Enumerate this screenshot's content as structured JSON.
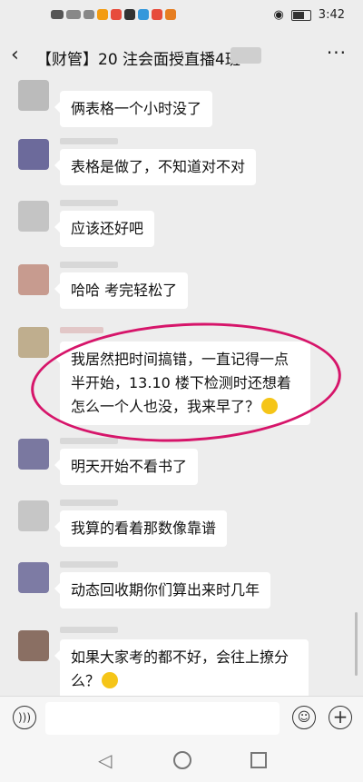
{
  "status_bar": {
    "time": "3:42"
  },
  "nav": {
    "back_icon": "chevron-left-icon",
    "title": "【财管】20 注会面授直播4班",
    "more_label": "···"
  },
  "messages": [
    {
      "text": "俩表格一个小时没了"
    },
    {
      "text": "表格是做了，不知道对不对"
    },
    {
      "text": "应该还好吧"
    },
    {
      "text": "哈哈 考完轻松了"
    },
    {
      "text": "我居然把时间搞错，一直记得一点半开始，13.10 楼下检测时还想着怎么一个人也没，我来早了？"
    },
    {
      "text": "明天开始不看书了"
    },
    {
      "text": "我算的看着那数像靠谱"
    },
    {
      "text": "动态回收期你们算出来时几年"
    },
    {
      "text": "如果大家考的都不好，会往上撩分么？"
    }
  ],
  "colors": {
    "annotation_circle": "#d6156a",
    "bubble": "#ffffff",
    "background": "#ededed"
  }
}
